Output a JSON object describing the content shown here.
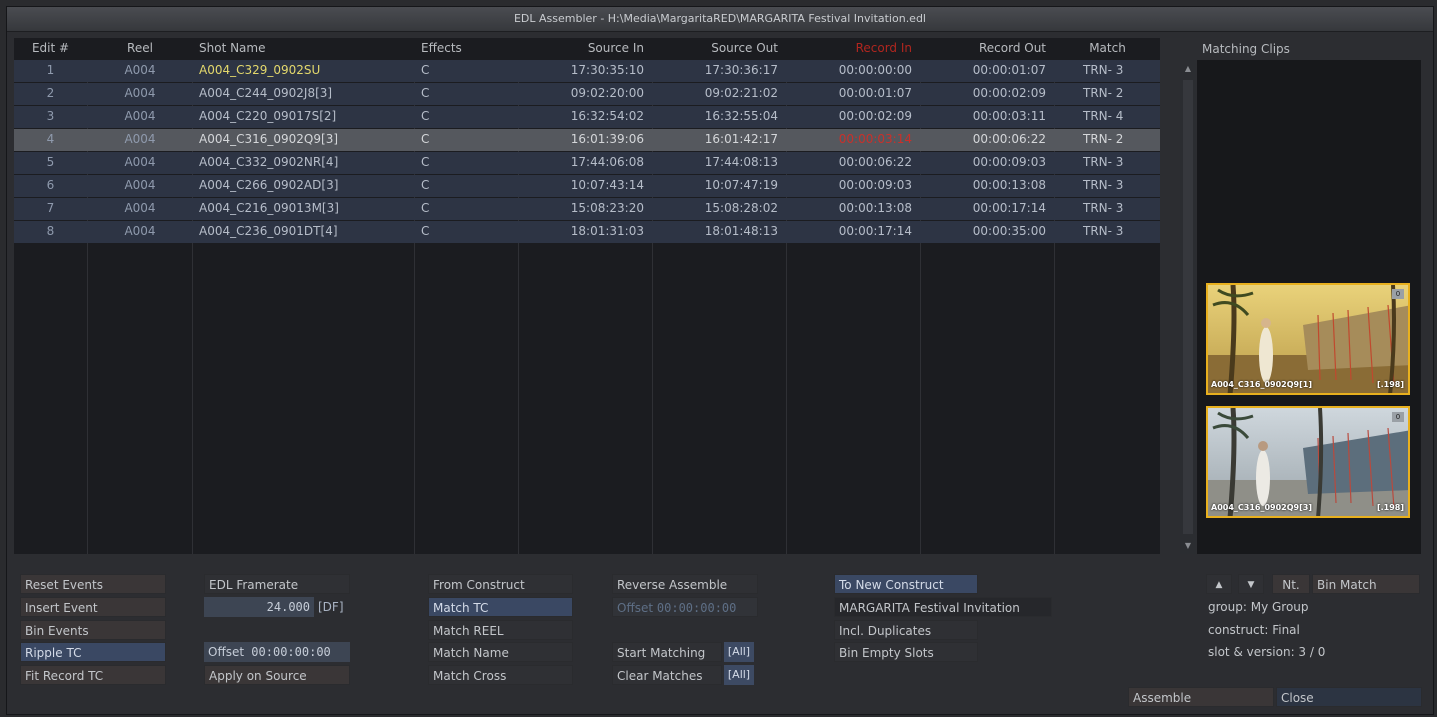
{
  "window": {
    "title": "EDL Assembler - H:\\Media\\MargaritaRED\\MARGARITA Festival Invitation.edl"
  },
  "table": {
    "headers": [
      "Edit #",
      "Reel",
      "Shot Name",
      "Effects",
      "Source In",
      "Source Out",
      "Record In",
      "Record Out",
      "Match"
    ],
    "rows": [
      [
        "1",
        "A004",
        "A004_C329_0902SU",
        "C",
        "17:30:35:10",
        "17:30:36:17",
        "00:00:00:00",
        "00:00:01:07",
        "TRN- 3"
      ],
      [
        "2",
        "A004",
        "A004_C244_0902J8[3]",
        "C",
        "09:02:20:00",
        "09:02:21:02",
        "00:00:01:07",
        "00:00:02:09",
        "TRN- 2"
      ],
      [
        "3",
        "A004",
        "A004_C220_09017S[2]",
        "C",
        "16:32:54:02",
        "16:32:55:04",
        "00:00:02:09",
        "00:00:03:11",
        "TRN- 4"
      ],
      [
        "4",
        "A004",
        "A004_C316_0902Q9[3]",
        "C",
        "16:01:39:06",
        "16:01:42:17",
        "00:00:03:14",
        "00:00:06:22",
        "TRN- 2"
      ],
      [
        "5",
        "A004",
        "A004_C332_0902NR[4]",
        "C",
        "17:44:06:08",
        "17:44:08:13",
        "00:00:06:22",
        "00:00:09:03",
        "TRN- 3"
      ],
      [
        "6",
        "A004",
        "A004_C266_0902AD[3]",
        "C",
        "10:07:43:14",
        "10:07:47:19",
        "00:00:09:03",
        "00:00:13:08",
        "TRN- 3"
      ],
      [
        "7",
        "A004",
        "A004_C216_09013M[3]",
        "C",
        "15:08:23:20",
        "15:08:28:02",
        "00:00:13:08",
        "00:00:17:14",
        "TRN- 3"
      ],
      [
        "8",
        "A004",
        "A004_C236_0901DT[4]",
        "C",
        "18:01:31:03",
        "18:01:48:13",
        "00:00:17:14",
        "00:00:35:00",
        "TRN- 3"
      ]
    ],
    "selected_row": 4
  },
  "matching": {
    "title": "Matching Clips",
    "clips": [
      {
        "name": "A004_C316_0902Q9[1]",
        "tag": "[.198]",
        "corner": "0"
      },
      {
        "name": "A004_C316_0902Q9[3]",
        "tag": "[.198]",
        "corner": "0"
      }
    ],
    "nt_label": "Nt.",
    "bin_match_label": "Bin Match",
    "group": "group: My Group",
    "construct": "construct: Final",
    "slot": "slot & version: 3 / 0"
  },
  "controls": {
    "reset_events": "Reset Events",
    "insert_event": "Insert Event",
    "bin_events": "Bin Events",
    "ripple_tc": "Ripple TC",
    "fit_record_tc": "Fit Record TC",
    "edl_framerate": "EDL Framerate",
    "framerate_value": "24.000",
    "framerate_df": "[DF]",
    "offset_label": "Offset",
    "offset_value": "00:00:00:00",
    "apply_on_source": "Apply on Source",
    "from_construct": "From Construct",
    "match_tc": "Match TC",
    "match_reel": "Match REEL",
    "match_name": "Match Name",
    "match_cross": "Match Cross",
    "reverse_assemble": "Reverse Assemble",
    "offset_disabled_label": "Offset",
    "offset_disabled_value": "00:00:00:00",
    "start_matching": "Start Matching",
    "clear_matches": "Clear Matches",
    "all_tag": "[All]",
    "to_new_construct": "To New Construct",
    "construct_name": "MARGARITA Festival Invitation",
    "incl_duplicates": "Incl. Duplicates",
    "bin_empty_slots": "Bin Empty Slots",
    "assemble": "Assemble",
    "close": "Close"
  }
}
